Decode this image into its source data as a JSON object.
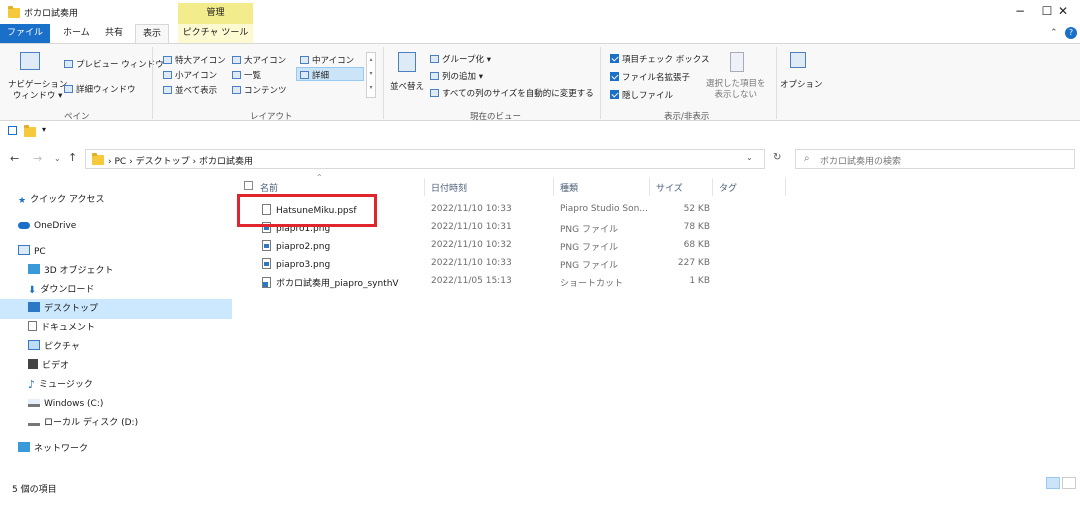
{
  "window": {
    "title": "ボカロ試奏用",
    "manage_label": "管理",
    "controls": {
      "minimize": "−",
      "maximize": "☐",
      "close": "✕"
    }
  },
  "tabs": [
    {
      "label": "ファイル"
    },
    {
      "label": "ホーム"
    },
    {
      "label": "共有"
    },
    {
      "label": "表示"
    },
    {
      "label": "ピクチャ ツール"
    }
  ],
  "ribbon": {
    "pane": {
      "navigation_pane": "ナビゲーション\nウィンドウ ▾",
      "preview_pane": "プレビュー ウィンドウ",
      "details_pane": "詳細ウィンドウ",
      "group_label": "ペイン"
    },
    "layout": {
      "items": [
        "特大アイコン",
        "大アイコン",
        "中アイコン",
        "小アイコン",
        "一覧",
        "詳細",
        "並べて表示",
        "コンテンツ"
      ],
      "selected": "詳細",
      "group_label": "レイアウト"
    },
    "current_view": {
      "sort": "並べ替え",
      "group_by": "グループ化 ▾",
      "add_columns": "列の追加 ▾",
      "fit_columns": "すべての列のサイズを自動的に変更する",
      "group_label": "現在のビュー"
    },
    "show_hide": {
      "item_checkboxes": "項目チェック ボックス",
      "file_extensions": "ファイル名拡張子",
      "hidden_items": "隠しファイル",
      "hide_selected": "選択した項目を\n表示しない",
      "group_label": "表示/非表示"
    },
    "options": "オプション"
  },
  "address": {
    "crumbs": [
      "PC",
      "デスクトップ",
      "ボカロ試奏用"
    ],
    "search_placeholder": "ボカロ試奏用の検索"
  },
  "nav": [
    {
      "label": "クイック アクセス"
    },
    {
      "label": "OneDrive"
    },
    {
      "label": "PC"
    },
    {
      "label": "3D オブジェクト"
    },
    {
      "label": "ダウンロード"
    },
    {
      "label": "デスクトップ"
    },
    {
      "label": "ドキュメント"
    },
    {
      "label": "ピクチャ"
    },
    {
      "label": "ビデオ"
    },
    {
      "label": "ミュージック"
    },
    {
      "label": "Windows (C:)"
    },
    {
      "label": "ローカル ディスク (D:)"
    },
    {
      "label": "ネットワーク"
    }
  ],
  "columns": {
    "name": "名前",
    "date": "日付時刻",
    "type": "種類",
    "size": "サイズ",
    "tag": "タグ"
  },
  "files": [
    {
      "name": "HatsuneMiku.ppsf",
      "date": "2022/11/10 10:33",
      "type": "Piapro Studio Son...",
      "size": "52 KB"
    },
    {
      "name": "piapro1.png",
      "date": "2022/11/10 10:31",
      "type": "PNG ファイル",
      "size": "78 KB"
    },
    {
      "name": "piapro2.png",
      "date": "2022/11/10 10:32",
      "type": "PNG ファイル",
      "size": "68 KB"
    },
    {
      "name": "piapro3.png",
      "date": "2022/11/10 10:33",
      "type": "PNG ファイル",
      "size": "227 KB"
    },
    {
      "name": "ボカロ試奏用_piapro_synthV",
      "date": "2022/11/05 15:13",
      "type": "ショートカット",
      "size": "1 KB"
    }
  ],
  "status": {
    "count": "5 個の項目"
  },
  "colors": {
    "accent": "#1a6fc9",
    "selection": "#cce8ff",
    "highlight": "#e0252c"
  }
}
